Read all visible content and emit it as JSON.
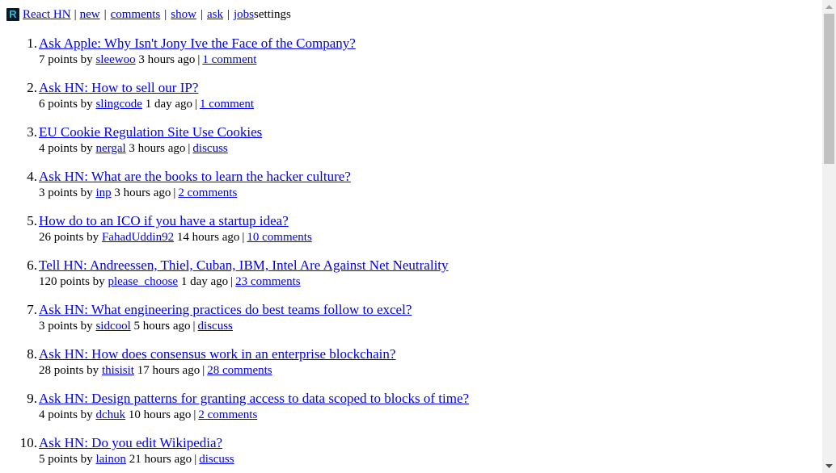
{
  "header": {
    "logo_letter": "R",
    "brand": "React HN",
    "nav": {
      "new": "new",
      "comments": "comments",
      "show": "show",
      "ask": "ask",
      "jobs": "jobs",
      "settings": "settings",
      "separator": "|"
    }
  },
  "stories": [
    {
      "num": "1.",
      "title": "Ask Apple: Why Isn't Jony Ive the Face of the Company?",
      "points": "7 points by",
      "user": "sleewoo",
      "age": "3 hours ago",
      "comments": "1 comment"
    },
    {
      "num": "2.",
      "title": "Ask HN: How to sell our IP?",
      "points": "6 points by",
      "user": "slingcode",
      "age": "1 day ago",
      "comments": "1 comment"
    },
    {
      "num": "3.",
      "title": "EU Cookie Regulation Site Use Cookies",
      "points": "4 points by",
      "user": "nergal",
      "age": "3 hours ago",
      "comments": "discuss"
    },
    {
      "num": "4.",
      "title": "Ask HN: What are the books to learn the hacker culture?",
      "points": "3 points by",
      "user": "inp",
      "age": "3 hours ago",
      "comments": "2 comments"
    },
    {
      "num": "5.",
      "title": "How do to an ICO if you have a startup idea?",
      "points": "26 points by",
      "user": "FahadUddin92",
      "age": "14 hours ago",
      "comments": "10 comments"
    },
    {
      "num": "6.",
      "title": "Tell HN: Andreessen, Thiel, Cuban, IBM, Intel Are Against Net Neutrality",
      "points": "120 points by",
      "user": "please_choose",
      "age": "1 day ago",
      "comments": "23 comments"
    },
    {
      "num": "7.",
      "title": "Ask HN: What engineering practices do best teams follow to excel?",
      "points": "3 points by",
      "user": "sidcool",
      "age": "5 hours ago",
      "comments": "discuss"
    },
    {
      "num": "8.",
      "title": "Ask HN: How does consensus work in an enterprise blockchain?",
      "points": "28 points by",
      "user": "thisisit",
      "age": "17 hours ago",
      "comments": "28 comments"
    },
    {
      "num": "9.",
      "title": "Ask HN: Design patterns for granting access to data scoped to blocks of time?",
      "points": "4 points by",
      "user": "dchuk",
      "age": "10 hours ago",
      "comments": "2 comments"
    },
    {
      "num": "10.",
      "title": "Ask HN: Do you edit Wikipedia?",
      "points": "5 points by",
      "user": "lainon",
      "age": "21 hours ago",
      "comments": "discuss"
    }
  ],
  "scrollbar": {
    "up_icon": "scroll-up-arrow-icon",
    "down_icon": "scroll-down-arrow-icon"
  }
}
